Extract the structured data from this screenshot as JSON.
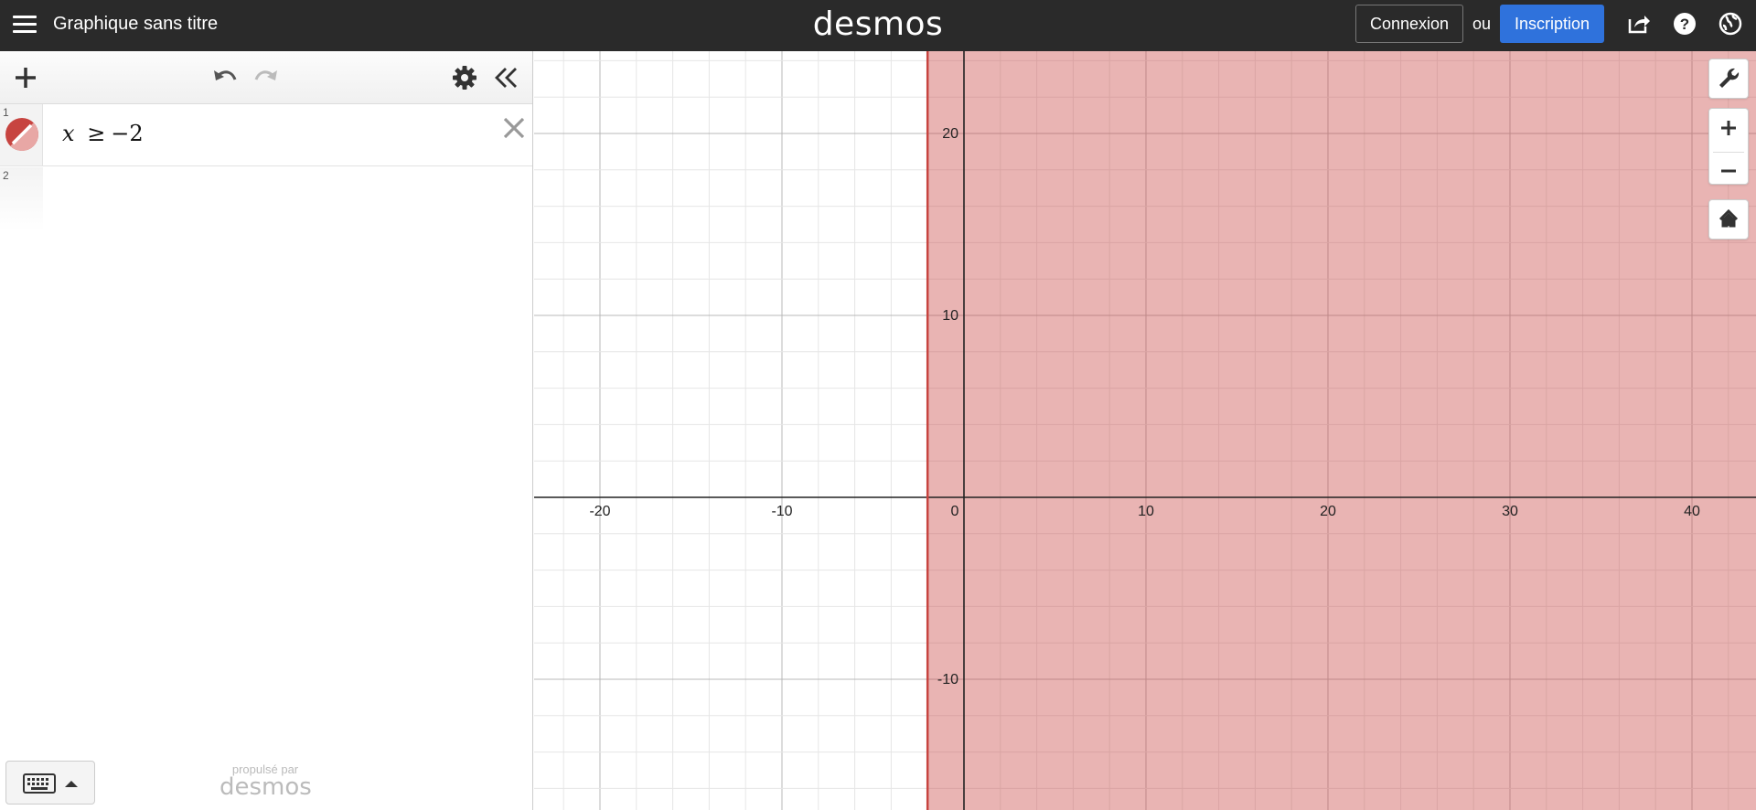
{
  "header": {
    "graph_title": "Graphique sans titre",
    "logo_text": "desmos",
    "login_label": "Connexion",
    "or_label": "ou",
    "signup_label": "Inscription",
    "signup_color": "#2f72dc",
    "bar_color": "#2a2a2a"
  },
  "expressions": [
    {
      "index": "1",
      "latex_lhs": "x",
      "operator": "≥",
      "rhs": "−2",
      "color": "#c74440"
    },
    {
      "index": "2"
    }
  ],
  "footer": {
    "powered_by": "propulsé par",
    "brand": "desmos"
  },
  "graph": {
    "x_ticks": [
      "-20",
      "-10",
      "0",
      "10",
      "20",
      "30",
      "40"
    ],
    "y_ticks": [
      "20",
      "10",
      "-10"
    ],
    "boundary_x": -2,
    "shade_color": "#c74440",
    "icons": [
      "wrench-icon",
      "zoom-in-icon",
      "zoom-out-icon",
      "home-icon"
    ]
  }
}
